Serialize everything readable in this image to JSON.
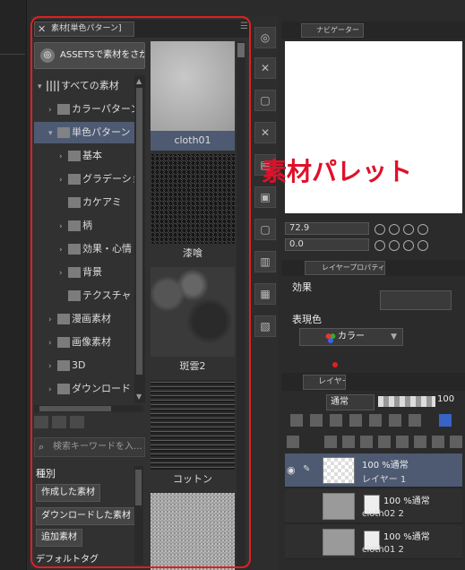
{
  "material_panel": {
    "tab_label": "素材[単色パターン]",
    "assets_button": "ASSETSで素材をさがす",
    "tree": [
      {
        "label": "すべての素材",
        "level": 0,
        "expanded": true
      },
      {
        "label": "カラーパターン",
        "level": 1,
        "expanded": false
      },
      {
        "label": "単色パターン",
        "level": 1,
        "expanded": true,
        "selected": true
      },
      {
        "label": "基本",
        "level": 2,
        "expanded": false
      },
      {
        "label": "グラデーション",
        "level": 2,
        "expanded": false
      },
      {
        "label": "カケアミ",
        "level": 2,
        "expanded": null
      },
      {
        "label": "柄",
        "level": 2,
        "expanded": false
      },
      {
        "label": "効果・心情",
        "level": 2,
        "expanded": false
      },
      {
        "label": "背景",
        "level": 2,
        "expanded": false
      },
      {
        "label": "テクスチャ",
        "level": 2,
        "expanded": null
      },
      {
        "label": "漫画素材",
        "level": 1,
        "expanded": false
      },
      {
        "label": "画像素材",
        "level": 1,
        "expanded": false
      },
      {
        "label": "3D",
        "level": 1,
        "expanded": false
      },
      {
        "label": "ダウンロード",
        "level": 1,
        "expanded": false
      }
    ],
    "search_placeholder": "検索キーワードを入...",
    "kind_label": "種別",
    "tag_buttons": [
      "作成した素材",
      "ダウンロードした素材",
      "追加素材"
    ],
    "default_tag_label": "デフォルトタグ",
    "materials": [
      {
        "name": "cloth01",
        "selected": true
      },
      {
        "name": "漆喰",
        "selected": false
      },
      {
        "name": "斑雲2",
        "selected": false
      },
      {
        "name": "コットン",
        "selected": false
      },
      {
        "name": "",
        "selected": false
      }
    ]
  },
  "annotation_text": "素材パレット",
  "navigator": {
    "tab_label": "ナビゲーター",
    "zoom_value": "72.9",
    "rotation_value": "0.0"
  },
  "layer_property": {
    "tab_label": "レイヤープロパティ",
    "effect_label": "効果",
    "expression_label": "表現色",
    "color_mode": "カラー"
  },
  "layers_panel": {
    "tab_label": "レイヤー",
    "blend_mode": "通常",
    "opacity_value": "100",
    "layers": [
      {
        "mode": "100 %通常",
        "name": "レイヤー 1",
        "selected": true
      },
      {
        "mode": "100 %通常",
        "name": "cloth02 2",
        "selected": false
      },
      {
        "mode": "100 %通常",
        "name": "cloth01 2",
        "selected": false
      }
    ]
  },
  "colors": {
    "highlight": "#e02020",
    "selection": "#4d5a72",
    "panel_bg": "#313131"
  }
}
